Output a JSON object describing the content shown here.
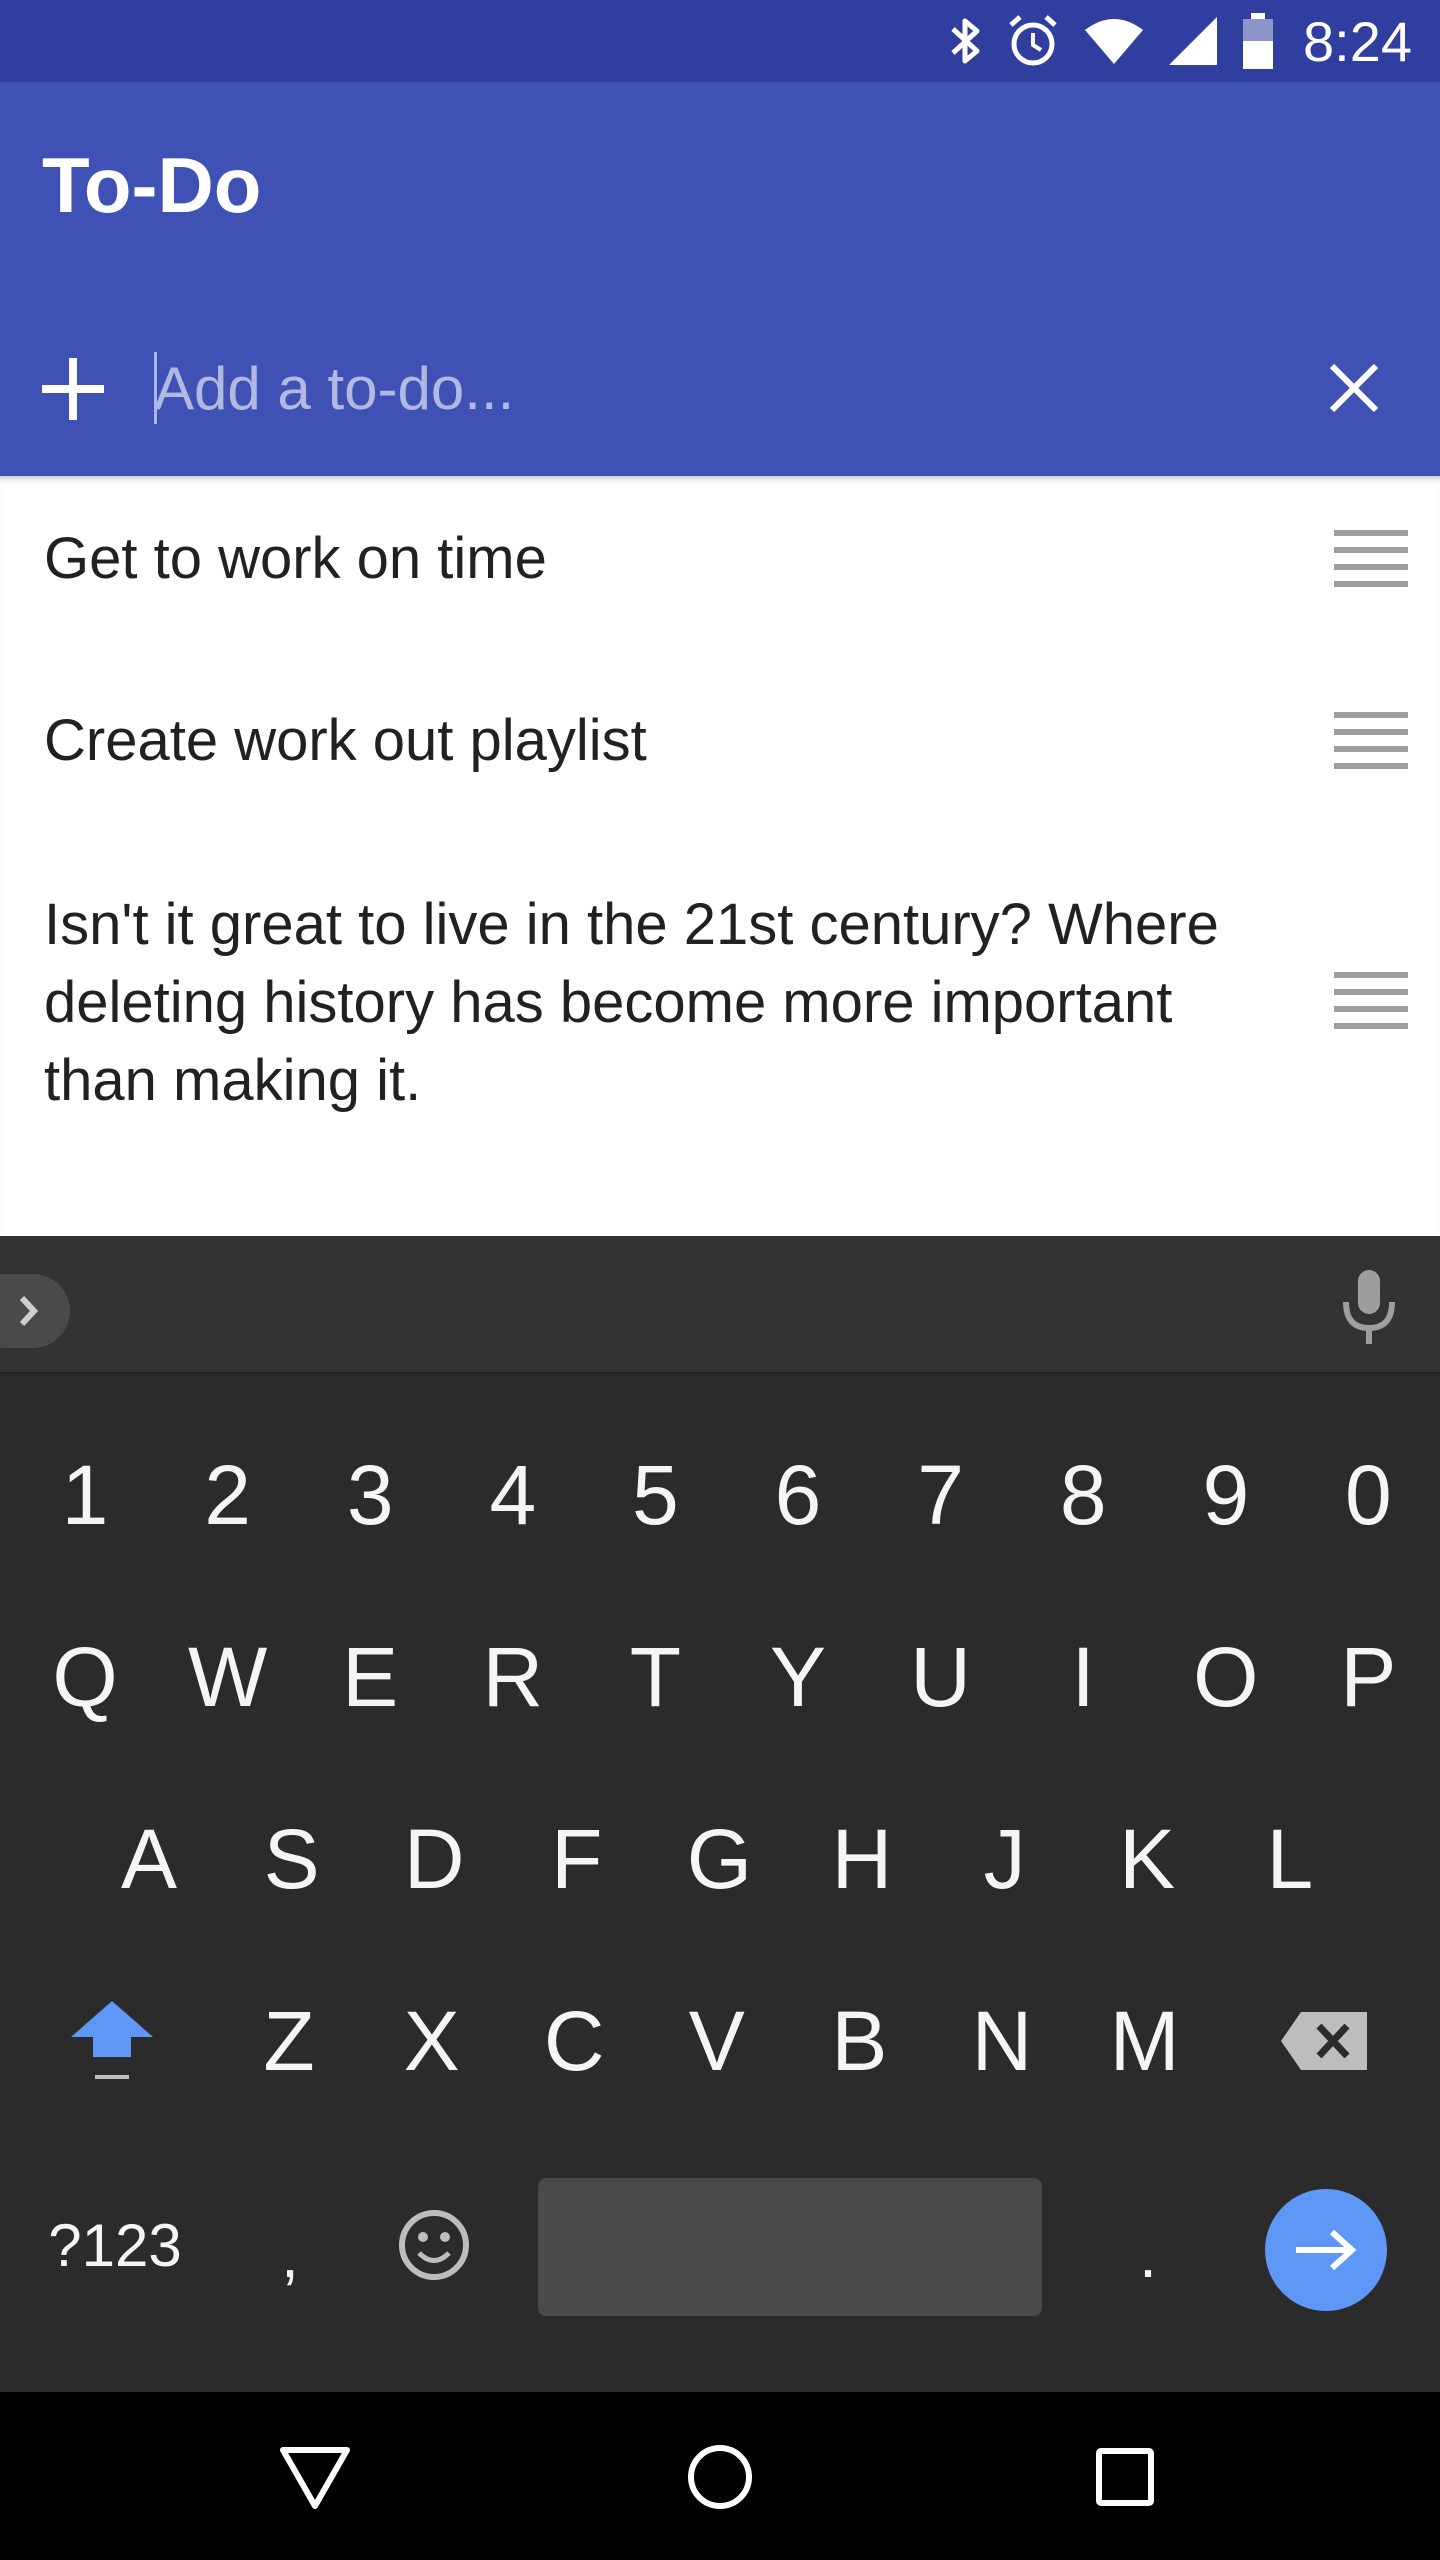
{
  "status_bar": {
    "time": "8:24",
    "icons": [
      "bluetooth-icon",
      "alarm-icon",
      "wifi-icon",
      "cell-signal-icon",
      "battery-icon"
    ]
  },
  "app": {
    "title": "To-Do",
    "primary_color": "#3f51b5",
    "status_color": "#303f9f"
  },
  "add_todo": {
    "placeholder": "Add a to-do...",
    "value": ""
  },
  "todos": [
    {
      "text": "Get to work on time"
    },
    {
      "text": "Create work out playlist"
    },
    {
      "text": "Isn't it great to live in the 21st century? Where deleting history has become more important than making it."
    }
  ],
  "keyboard": {
    "number_row": [
      "1",
      "2",
      "3",
      "4",
      "5",
      "6",
      "7",
      "8",
      "9",
      "0"
    ],
    "row1": [
      "Q",
      "W",
      "E",
      "R",
      "T",
      "Y",
      "U",
      "I",
      "O",
      "P"
    ],
    "row2": [
      "A",
      "S",
      "D",
      "F",
      "G",
      "H",
      "J",
      "K",
      "L"
    ],
    "row3": [
      "Z",
      "X",
      "C",
      "V",
      "B",
      "N",
      "M"
    ],
    "symbols_label": "?123",
    "comma_label": ",",
    "period_label": ".",
    "accent_color": "#5e97f6"
  },
  "nav_bar": {
    "buttons": [
      "back-icon",
      "home-icon",
      "recents-icon"
    ]
  }
}
